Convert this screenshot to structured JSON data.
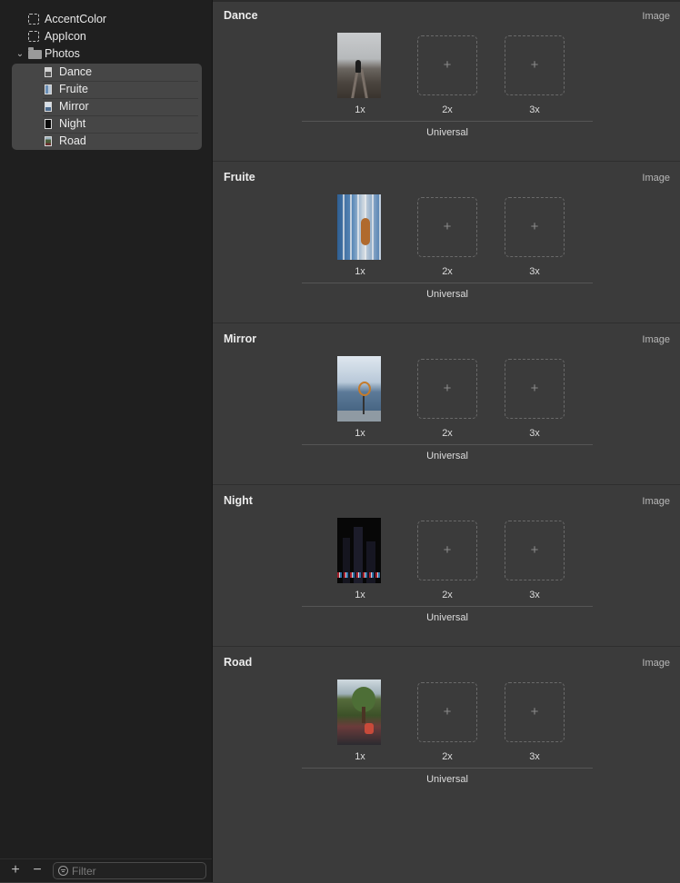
{
  "sidebar": {
    "items": [
      {
        "label": "AccentColor",
        "icon": "color-set-icon"
      },
      {
        "label": "AppIcon",
        "icon": "app-icon-set-icon"
      },
      {
        "label": "Photos",
        "icon": "folder-icon",
        "expanded": true
      }
    ],
    "photos": [
      {
        "label": "Dance",
        "icon": "image-set-icon"
      },
      {
        "label": "Fruite",
        "icon": "image-set-icon"
      },
      {
        "label": "Mirror",
        "icon": "image-set-icon"
      },
      {
        "label": "Night",
        "icon": "image-set-icon"
      },
      {
        "label": "Road",
        "icon": "image-set-icon"
      }
    ],
    "bottom": {
      "add_symbol": "+",
      "remove_symbol": "−",
      "filter_placeholder": "Filter"
    }
  },
  "assets": [
    {
      "name": "Dance",
      "type": "Image",
      "slots": [
        "1x",
        "2x",
        "3x"
      ],
      "footer": "Universal"
    },
    {
      "name": "Fruite",
      "type": "Image",
      "slots": [
        "1x",
        "2x",
        "3x"
      ],
      "footer": "Universal"
    },
    {
      "name": "Mirror",
      "type": "Image",
      "slots": [
        "1x",
        "2x",
        "3x"
      ],
      "footer": "Universal"
    },
    {
      "name": "Night",
      "type": "Image",
      "slots": [
        "1x",
        "2x",
        "3x"
      ],
      "footer": "Universal"
    },
    {
      "name": "Road",
      "type": "Image",
      "slots": [
        "1x",
        "2x",
        "3x"
      ],
      "footer": "Universal"
    }
  ],
  "empty_slot_symbol": "+",
  "colors": {
    "sidebar_bg": "#1f1f1f",
    "main_bg": "#3b3b3b",
    "selection_bg": "#464646"
  }
}
